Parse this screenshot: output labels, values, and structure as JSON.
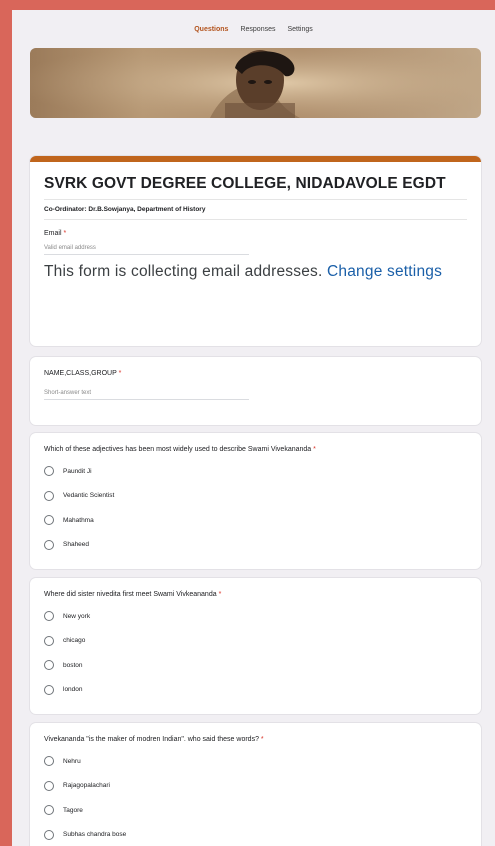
{
  "tabs": [
    {
      "label": "Questions",
      "active": true
    },
    {
      "label": "Responses",
      "active": false
    },
    {
      "label": "Settings",
      "active": false
    }
  ],
  "form": {
    "title": "SVRK GOVT DEGREE COLLEGE, NIDADAVOLE EGDT",
    "description": "Co-Ordinator: Dr.B.Sowjanya, Department of History",
    "email_label": "Email",
    "email_placeholder": "Valid email address",
    "notice_text": "This form is collecting email addresses.",
    "notice_link": "Change settings",
    "accent_color": "#c0651c"
  },
  "questions": [
    {
      "label": "NAME,CLASS,GROUP",
      "required": true,
      "type": "short-answer",
      "placeholder": "Short-answer text"
    },
    {
      "label": "Which of these adjectives has been most widely used to describe Swami Vivekananda",
      "required": true,
      "type": "multiple-choice",
      "options": [
        "Paundit Ji",
        "Vedantic Scientist",
        "Mahathma",
        "Shaheed"
      ]
    },
    {
      "label": "Where did sister nivedita first meet Swami Vivkeananda",
      "required": true,
      "type": "multiple-choice",
      "options": [
        "New york",
        "chicago",
        "boston",
        "london"
      ]
    },
    {
      "label": "Vivekananda \"is the maker of modren Indian\". who said these words?",
      "required": true,
      "type": "multiple-choice",
      "options": [
        "Nehru",
        "Rajagopalachari",
        "Tagore",
        "Subhas chandra bose"
      ]
    }
  ]
}
